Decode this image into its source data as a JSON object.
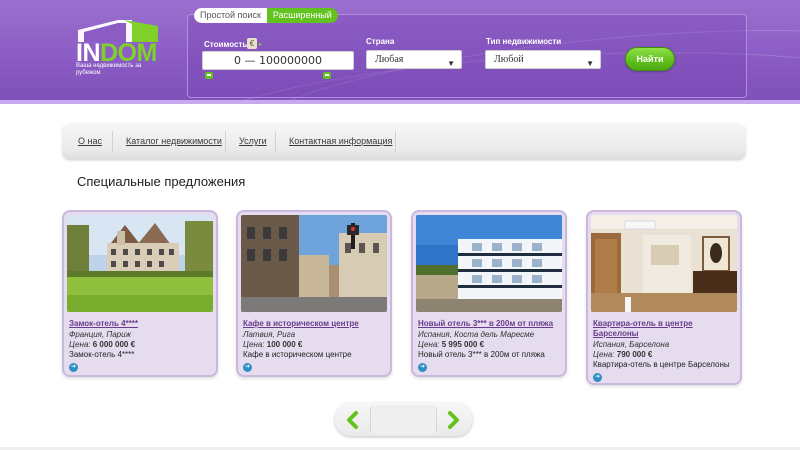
{
  "logo": {
    "word_in": "IN",
    "word_dom": "DOM",
    "tagline": "Ваша недвижимость за рубежом"
  },
  "search": {
    "tabs": [
      {
        "label": "Простой поиск",
        "active": false
      },
      {
        "label": "Расширенный",
        "active": true
      }
    ],
    "price_label": "Стоимость",
    "currency": "€",
    "price_value": "0 — 100000000",
    "country_label": "Страна",
    "country_value": "Любая",
    "type_label": "Тип недвижимости",
    "type_value": "Любой",
    "submit_label": "Найти"
  },
  "nav": {
    "items": [
      {
        "label": "О нас"
      },
      {
        "label": "Каталог недвижимости"
      },
      {
        "label": "Услуги"
      },
      {
        "label": "Контактная информация"
      }
    ]
  },
  "main": {
    "section_title": "Специальные предложения",
    "price_prefix": "Цена:",
    "cards": [
      {
        "name": "Замок-отель 4****",
        "location": "Франция, Париж",
        "price": "6 000 000 €",
        "description": "Замок-отель 4****"
      },
      {
        "name": "Кафе в историческом центре",
        "location": "Латвия, Рига",
        "price": "100 000 €",
        "description": "Кафе в историческом центре"
      },
      {
        "name": "Новый отель 3*** в 200м от пляжа",
        "location": "Испания, Коста дель Маресме",
        "price": "5 995 000 €",
        "description": "Новый отель 3*** в 200м от пляжа"
      },
      {
        "name": "Квартира-отель в центре Барселоны",
        "location": "Испания, Барселона",
        "price": "790 000 €",
        "description": "Квартира-отель в центре Барселоны"
      }
    ]
  },
  "colors": {
    "header_purple": "#8b5cc4",
    "accent_green": "#62c21e",
    "card_bg": "#e6dcef",
    "link_purple": "#6a3c8c"
  },
  "icons": {
    "more": "arrow-circle-right-icon",
    "pager_prev": "chevron-left-icon",
    "pager_next": "chevron-right-icon",
    "select_caret": "caret-down-icon"
  }
}
